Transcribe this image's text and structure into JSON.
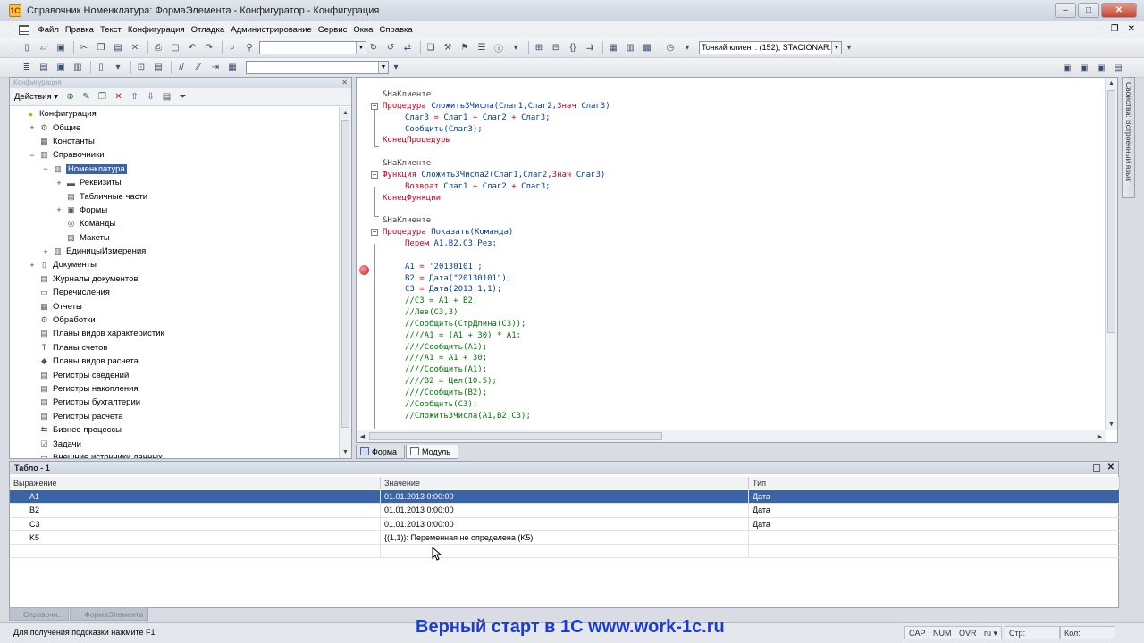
{
  "window": {
    "title": "Справочник Номенклатура: ФормаЭлемента - Конфигуратор - Конфигурация",
    "min": "‒",
    "max": "□",
    "close": "✕"
  },
  "menu": [
    "Файл",
    "Правка",
    "Текст",
    "Конфигурация",
    "Отладка",
    "Администрирование",
    "Сервис",
    "Окна",
    "Справка"
  ],
  "mdi_buttons": [
    "‒",
    "❐",
    "✕"
  ],
  "toolbar": {
    "client_combo": "Тонкий клиент: (152), STACIONAR:`"
  },
  "config_panel": {
    "header": "Конфигурация",
    "actions_label": "Действия ▾",
    "close": "✕",
    "tree": [
      {
        "label": "Конфигурация",
        "icon": "config-icon"
      },
      {
        "label": "Общие",
        "icon": "common-icon",
        "exp": "+"
      },
      {
        "label": "Константы",
        "icon": "constants-icon"
      },
      {
        "label": "Справочники",
        "icon": "catalog-icon",
        "exp": "−"
      },
      {
        "label": "Номенклатура",
        "icon": "catalog-icon",
        "exp": "−",
        "selected": true
      },
      {
        "label": "Реквизиты",
        "icon": "attributes-icon",
        "exp": "+"
      },
      {
        "label": "Табличные части",
        "icon": "tabular-icon"
      },
      {
        "label": "Формы",
        "icon": "forms-icon",
        "exp": "+"
      },
      {
        "label": "Команды",
        "icon": "commands-icon"
      },
      {
        "label": "Макеты",
        "icon": "templates-icon"
      },
      {
        "label": "ЕдиницыИзмерения",
        "icon": "catalog-icon",
        "exp": "+"
      },
      {
        "label": "Документы",
        "icon": "documents-icon",
        "exp": "+"
      },
      {
        "label": "Журналы документов",
        "icon": "journals-icon"
      },
      {
        "label": "Перечисления",
        "icon": "enums-icon"
      },
      {
        "label": "Отчеты",
        "icon": "reports-icon"
      },
      {
        "label": "Обработки",
        "icon": "processing-icon"
      },
      {
        "label": "Планы видов характеристик",
        "icon": "char-types-icon"
      },
      {
        "label": "Планы счетов",
        "icon": "accounts-icon"
      },
      {
        "label": "Планы видов расчета",
        "icon": "calc-types-icon"
      },
      {
        "label": "Регистры сведений",
        "icon": "info-register-icon"
      },
      {
        "label": "Регистры накопления",
        "icon": "accum-register-icon"
      },
      {
        "label": "Регистры бухгалтерии",
        "icon": "acc-register-icon"
      },
      {
        "label": "Регистры расчета",
        "icon": "calc-register-icon"
      },
      {
        "label": "Бизнес-процессы",
        "icon": "business-process-icon"
      },
      {
        "label": "Задачи",
        "icon": "tasks-icon"
      },
      {
        "label": "Внешние источники данных",
        "icon": "external-sources-icon"
      }
    ]
  },
  "code": [
    {
      "indent": 0,
      "parts": [
        [
          "dir",
          "&НаКлиенте"
        ]
      ]
    },
    {
      "indent": 0,
      "fold": "−",
      "parts": [
        [
          "kw",
          "Процедура "
        ],
        [
          "name",
          "Сложить3Числа"
        ],
        [
          "tx",
          "(Слаг1,Слаг2,"
        ],
        [
          "kw",
          "Знач "
        ],
        [
          "tx",
          "Слаг3)"
        ]
      ]
    },
    {
      "indent": 1,
      "parts": [
        [
          "tx",
          "Слаг3 "
        ],
        [
          "op",
          "= "
        ],
        [
          "tx",
          "Слаг1 "
        ],
        [
          "op",
          "+ "
        ],
        [
          "tx",
          "Слаг2 "
        ],
        [
          "op",
          "+ "
        ],
        [
          "tx",
          "Слаг3;"
        ]
      ]
    },
    {
      "indent": 1,
      "parts": [
        [
          "tx",
          "Сообщить(Слаг3);"
        ]
      ]
    },
    {
      "indent": 0,
      "parts": [
        [
          "kw",
          "КонецПроцедуры"
        ]
      ]
    },
    {
      "indent": 0,
      "parts": []
    },
    {
      "indent": 0,
      "parts": [
        [
          "dir",
          "&НаКлиенте"
        ]
      ]
    },
    {
      "indent": 0,
      "fold": "−",
      "parts": [
        [
          "kw",
          "Функция "
        ],
        [
          "name",
          "Сложить3Числа2"
        ],
        [
          "tx",
          "(Слаг1,Слаг2,"
        ],
        [
          "kw",
          "Знач "
        ],
        [
          "tx",
          "Слаг3)"
        ]
      ]
    },
    {
      "indent": 1,
      "parts": [
        [
          "kw",
          "Возврат "
        ],
        [
          "tx",
          "Слаг1 "
        ],
        [
          "op",
          "+ "
        ],
        [
          "tx",
          "Слаг2 "
        ],
        [
          "op",
          "+ "
        ],
        [
          "tx",
          "Слаг3;"
        ]
      ]
    },
    {
      "indent": 0,
      "parts": [
        [
          "kw",
          "КонецФункции"
        ]
      ]
    },
    {
      "indent": 0,
      "parts": []
    },
    {
      "indent": 0,
      "parts": [
        [
          "dir",
          "&НаКлиенте"
        ]
      ]
    },
    {
      "indent": 0,
      "fold": "−",
      "parts": [
        [
          "kw",
          "Процедура "
        ],
        [
          "name",
          "Показать"
        ],
        [
          "tx",
          "(Команда)"
        ]
      ]
    },
    {
      "indent": 1,
      "parts": [
        [
          "kw",
          "Перем "
        ],
        [
          "tx",
          "A1,B2,C3,Рез;"
        ]
      ]
    },
    {
      "indent": 0,
      "parts": []
    },
    {
      "indent": 1,
      "parts": [
        [
          "tx",
          "A1 "
        ],
        [
          "op",
          "= "
        ],
        [
          "tx",
          "'20130101';"
        ]
      ]
    },
    {
      "indent": 1,
      "parts": [
        [
          "tx",
          "B2 "
        ],
        [
          "op",
          "= "
        ],
        [
          "tx",
          "Дата(\"20130101\");"
        ]
      ]
    },
    {
      "indent": 1,
      "parts": [
        [
          "tx",
          "C3 "
        ],
        [
          "op",
          "= "
        ],
        [
          "tx",
          "Дата(2013,1,1);"
        ]
      ]
    },
    {
      "indent": 1,
      "parts": [
        [
          "cm",
          "//C3 = A1 + B2;"
        ]
      ]
    },
    {
      "indent": 1,
      "parts": [
        [
          "cm",
          "//Лев(C3,3)"
        ]
      ]
    },
    {
      "indent": 1,
      "parts": [
        [
          "cm",
          "//Сообщить(СтрДлина(C3));"
        ]
      ]
    },
    {
      "indent": 1,
      "parts": [
        [
          "cm",
          "////A1 = (A1 + 30) * A1;"
        ]
      ]
    },
    {
      "indent": 1,
      "parts": [
        [
          "cm",
          "////Сообщить(A1);"
        ]
      ]
    },
    {
      "indent": 1,
      "parts": [
        [
          "cm",
          "////A1 = A1 + 30;"
        ]
      ]
    },
    {
      "indent": 1,
      "parts": [
        [
          "cm",
          "////Сообщить(A1);"
        ]
      ]
    },
    {
      "indent": 1,
      "parts": [
        [
          "cm",
          "////B2 = Цел(10.5);"
        ]
      ]
    },
    {
      "indent": 1,
      "parts": [
        [
          "cm",
          "////Сообщить(B2);"
        ]
      ]
    },
    {
      "indent": 1,
      "parts": [
        [
          "cm",
          "//Сообщить(C3);"
        ]
      ]
    },
    {
      "indent": 1,
      "parts": [
        [
          "cm",
          "//Сложить3Числа(A1,B2,C3);"
        ]
      ]
    }
  ],
  "side_tab": "Свойства: Встроенный язык",
  "bottom_tabs": [
    "Форма",
    "Модуль"
  ],
  "tablo": {
    "title": "Табло - 1",
    "close": "✕",
    "columns": [
      "Выражение",
      "Значение",
      "Тип"
    ],
    "rows": [
      {
        "expr": "A1",
        "value": "01.01.2013 0:00:00",
        "type": "Дата",
        "selected": true
      },
      {
        "expr": "B2",
        "value": "01.01.2013 0:00:00",
        "type": "Дата"
      },
      {
        "expr": "C3",
        "value": "01.01.2013 0:00:00",
        "type": "Дата"
      },
      {
        "expr": "K5",
        "value": "{(1,1)}: Переменная не определена (K5)",
        "type": ""
      },
      {
        "expr": "",
        "value": "",
        "type": ""
      }
    ]
  },
  "window_tabs": [
    "Справочн...",
    "ФормаЭлемента"
  ],
  "status": {
    "hint": "Для получения подсказки нажмите F1",
    "watermark": "Верный старт в 1С www.work-1c.ru",
    "cap": "CAP",
    "num": "NUM",
    "ovr": "OVR",
    "lang": "ru ▾",
    "line": "Стр:",
    "col": "Кол:"
  }
}
